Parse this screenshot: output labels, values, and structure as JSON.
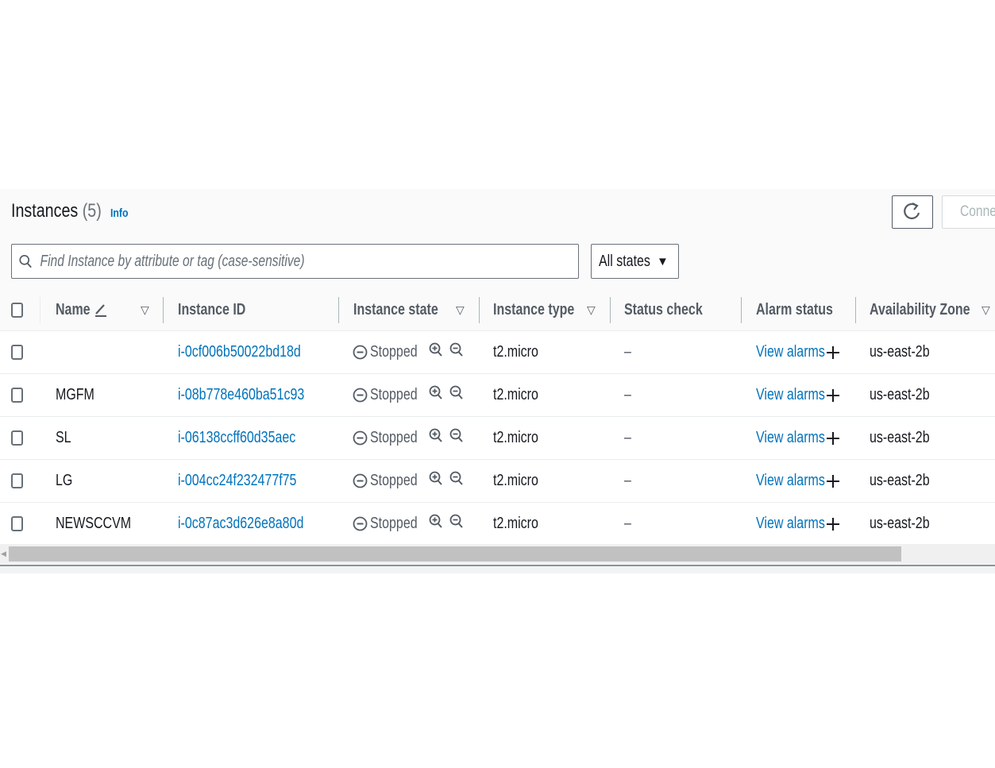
{
  "header": {
    "title": "Instances",
    "count": "(5)",
    "info_link": "Info",
    "refresh_icon": "refresh-icon",
    "connect_label": "Conne"
  },
  "filter": {
    "search_placeholder": "Find Instance by attribute or tag (case-sensitive)",
    "search_value": "",
    "search_icon": "search-icon",
    "state_select": "All states",
    "state_caret": "▼"
  },
  "table": {
    "columns": [
      {
        "label": "Name",
        "edit_icon": "pencil-icon",
        "sortable": true
      },
      {
        "label": "Instance ID",
        "sortable": false
      },
      {
        "label": "Instance state",
        "sortable": true
      },
      {
        "label": "Instance type",
        "sortable": true
      },
      {
        "label": "Status check",
        "sortable": false
      },
      {
        "label": "Alarm status",
        "sortable": false
      },
      {
        "label": "Availability Zone",
        "sortable": true
      }
    ],
    "sort_glyph": "▽",
    "rows": [
      {
        "name": "",
        "id": "i-0cf006b50022bd18d",
        "state": "Stopped",
        "type": "t2.micro",
        "status": "–",
        "alarm": "View alarms",
        "az": "us-east-2b"
      },
      {
        "name": "MGFM",
        "id": "i-08b778e460ba51c93",
        "state": "Stopped",
        "type": "t2.micro",
        "status": "–",
        "alarm": "View alarms",
        "az": "us-east-2b"
      },
      {
        "name": "SL",
        "id": "i-06138ccff60d35aec",
        "state": "Stopped",
        "type": "t2.micro",
        "status": "–",
        "alarm": "View alarms",
        "az": "us-east-2b"
      },
      {
        "name": "LG",
        "id": "i-004cc24f232477f75",
        "state": "Stopped",
        "type": "t2.micro",
        "status": "–",
        "alarm": "View alarms",
        "az": "us-east-2b"
      },
      {
        "name": "NEWSCCVM",
        "id": "i-0c87ac3d626e8a80d",
        "state": "Stopped",
        "type": "t2.micro",
        "status": "–",
        "alarm": "View alarms",
        "az": "us-east-2b"
      }
    ]
  },
  "colors": {
    "link": "#0073bb",
    "text": "#16191f",
    "muted": "#545b64",
    "stopped": "#687078"
  }
}
